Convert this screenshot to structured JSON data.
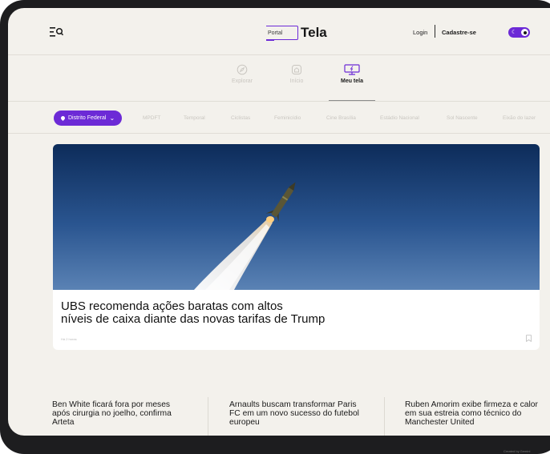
{
  "header": {
    "logo_small": "Portal",
    "logo_word": "Tela",
    "login_label": "Login",
    "signup_label": "Cadastre-se",
    "theme_toggle_icon": "moon-icon"
  },
  "nav": {
    "items": [
      {
        "label": "Explorar",
        "icon": "compass-icon",
        "active": false
      },
      {
        "label": "Início",
        "icon": "home-icon",
        "active": false
      },
      {
        "label": "Meu tela",
        "icon": "monitor-icon",
        "active": true
      }
    ]
  },
  "topics": {
    "region": "Distrito Federal",
    "items": [
      "MPDFT",
      "Temporal",
      "Ciclistas",
      "Feminicídio",
      "Cine Brasília",
      "Estádio Nacional",
      "Sol Nascente",
      "Eixão do lazer"
    ]
  },
  "hero": {
    "headline_line1": "UBS recomenda ações baratas com altos",
    "headline_line2": "níveis de caixa diante das novas tarifas de Trump",
    "meta": "Há 2 horas"
  },
  "stories": [
    {
      "title": "Ben White ficará fora por meses após cirurgia no joelho, confirma Arteta"
    },
    {
      "title": "Arnaults buscam transformar Paris FC em um novo sucesso do futebol europeu"
    },
    {
      "title": "Ruben Amorim exibe firmeza e calor em sua estreia como técnico do Manchester United"
    }
  ],
  "colors": {
    "accent": "#6c2ad6",
    "background": "#f3f1ec",
    "bezel": "#1d1d1f"
  },
  "footer_note": "Created by Gemini"
}
